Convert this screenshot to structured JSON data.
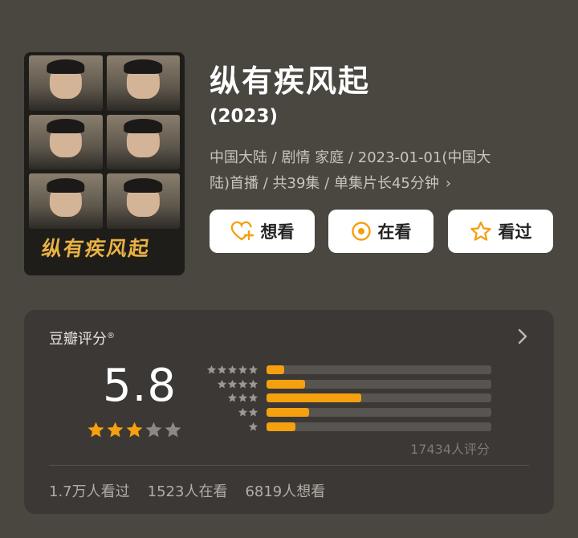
{
  "title": "纵有疾风起",
  "year": "(2023)",
  "poster": {
    "logo_text": "纵有疾风起"
  },
  "meta": {
    "line1": "中国大陆 / 剧情 家庭 / 2023-01-01(中国大",
    "line2": "陆)首播 / 共39集 / 单集片长45分钟",
    "chevron": "›"
  },
  "actions": {
    "want": "想看",
    "watching": "在看",
    "watched": "看过"
  },
  "colors": {
    "accent": "#f5a00f",
    "background": "#4a4640",
    "card": "#3b3835"
  },
  "rating": {
    "label": "豆瓣评分",
    "mark": "®",
    "score": "5.8",
    "stars_out_of_5": 3,
    "distribution": [
      {
        "stars": 5,
        "fraction": 0.08
      },
      {
        "stars": 4,
        "fraction": 0.17
      },
      {
        "stars": 3,
        "fraction": 0.42
      },
      {
        "stars": 2,
        "fraction": 0.19
      },
      {
        "stars": 1,
        "fraction": 0.13
      }
    ],
    "count_text": "17434人评分"
  },
  "stats": {
    "watched": "1.7万人看过",
    "watching": "1523人在看",
    "want": "6819人想看"
  }
}
